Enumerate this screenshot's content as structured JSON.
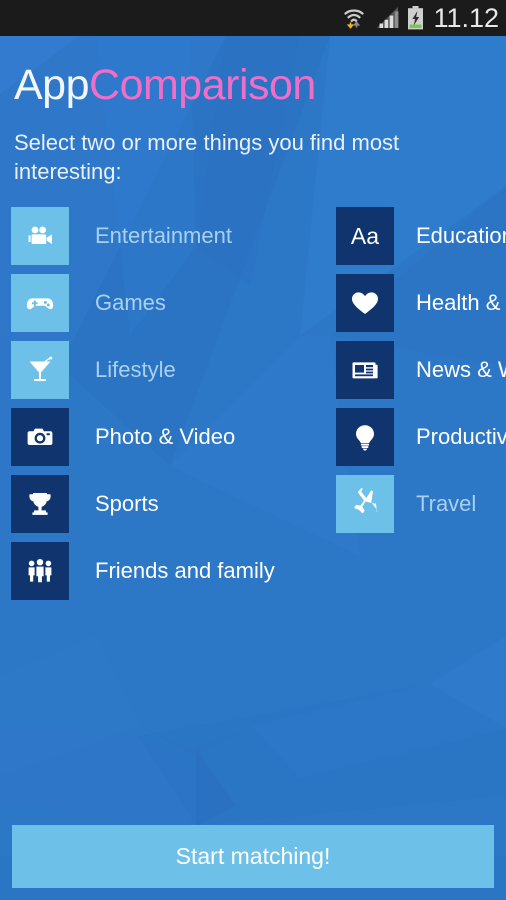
{
  "statusbar": {
    "time": "11.12",
    "icons": [
      "wifi-icon",
      "signal-icon",
      "battery-charging-icon"
    ]
  },
  "header": {
    "title_part1": "App",
    "title_part2": "Comparison",
    "subtitle": "Select two or more things you find most interesting:"
  },
  "colors": {
    "background_blue": "#2d77c7",
    "tile_selected": "#6dc0e8",
    "tile_unselected": "#10356e",
    "accent_pink": "#f06ec8",
    "label_selected": "#a9d1ee",
    "label_unselected": "#ffffff",
    "statusbar": "#1b1b1b",
    "button": "#6dc0e8"
  },
  "categories": {
    "left": [
      {
        "label": "Entertainment",
        "icon": "video-camera-icon",
        "selected": true
      },
      {
        "label": "Games",
        "icon": "gamepad-icon",
        "selected": true
      },
      {
        "label": "Lifestyle",
        "icon": "cocktail-icon",
        "selected": true
      },
      {
        "label": "Photo & Video",
        "icon": "camera-icon",
        "selected": false
      },
      {
        "label": "Sports",
        "icon": "trophy-icon",
        "selected": false
      },
      {
        "label": "Friends and family",
        "icon": "people-icon",
        "selected": false
      }
    ],
    "right": [
      {
        "label": "Education",
        "icon": "aa-text-icon",
        "selected": false
      },
      {
        "label": "Health &",
        "icon": "heart-icon",
        "selected": false
      },
      {
        "label": "News & W",
        "icon": "newspaper-icon",
        "selected": false
      },
      {
        "label": "Productiv",
        "icon": "lightbulb-icon",
        "selected": false
      },
      {
        "label": "Travel",
        "icon": "airplane-icon",
        "selected": true
      }
    ]
  },
  "footer": {
    "start_label": "Start matching!"
  }
}
